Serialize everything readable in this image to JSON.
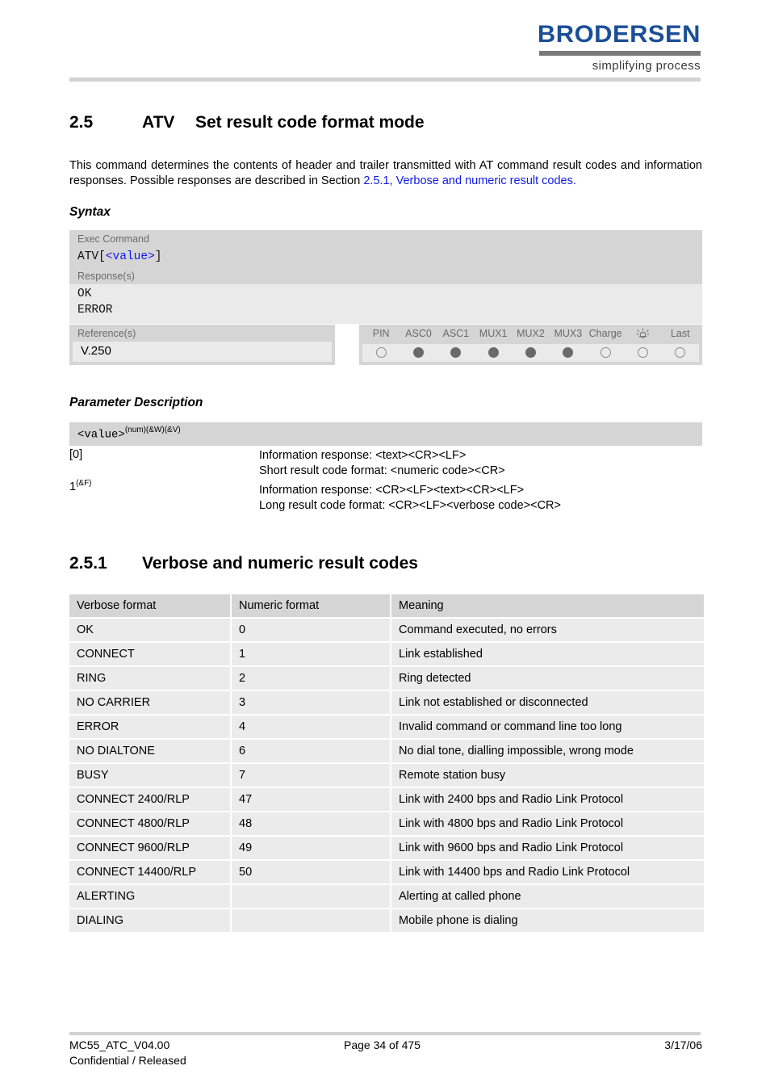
{
  "header": {
    "logo_word": "BRODERSEN",
    "logo_tagline": "simplifying process"
  },
  "section": {
    "number": "2.5",
    "command": "ATV",
    "title": "Set result code format mode"
  },
  "intro": {
    "text_before_link": "This command determines the contents of header and trailer transmitted with AT command result codes and information responses. Possible responses are described in Section ",
    "link_text": "2.5.1, Verbose and numeric result codes."
  },
  "syntax": {
    "heading": "Syntax",
    "exec_label": "Exec Command",
    "exec_prefix": "ATV[",
    "exec_value": "<value>",
    "exec_suffix": "]",
    "response_label": "Response(s)",
    "response_line1": "OK",
    "response_line2": "ERROR",
    "reference_label": "Reference(s)",
    "reference_value": "V.250",
    "indicators": [
      {
        "label": "PIN",
        "state": "empty"
      },
      {
        "label": "ASC0",
        "state": "filled"
      },
      {
        "label": "ASC1",
        "state": "filled"
      },
      {
        "label": "MUX1",
        "state": "filled"
      },
      {
        "label": "MUX2",
        "state": "filled"
      },
      {
        "label": "MUX3",
        "state": "filled"
      },
      {
        "label": "Charge",
        "state": "empty"
      },
      {
        "label": "alarm-bell-icon",
        "state": "empty"
      },
      {
        "label": "Last",
        "state": "empty"
      }
    ]
  },
  "parameter": {
    "heading": "Parameter Description",
    "name": "<value>",
    "name_sup": "(num)(&W)(&V)",
    "rows": [
      {
        "key": "[0]",
        "key_sup": "",
        "line1": "Information response: <text><CR><LF>",
        "line2": "Short result code format: <numeric code><CR>"
      },
      {
        "key": "1",
        "key_sup": "(&F)",
        "line1": "Information response: <CR><LF><text><CR><LF>",
        "line2": "Long result code format: <CR><LF><verbose code><CR>"
      }
    ]
  },
  "subsection": {
    "number": "2.5.1",
    "title": "Verbose and numeric result codes"
  },
  "codes_table": {
    "headers": [
      "Verbose format",
      "Numeric format",
      "Meaning"
    ],
    "rows": [
      [
        "OK",
        "0",
        "Command executed, no errors"
      ],
      [
        "CONNECT",
        "1",
        "Link established"
      ],
      [
        "RING",
        "2",
        "Ring detected"
      ],
      [
        "NO CARRIER",
        "3",
        "Link not established or disconnected"
      ],
      [
        "ERROR",
        "4",
        "Invalid command or command line too long"
      ],
      [
        "NO DIALTONE",
        "6",
        "No dial tone, dialling impossible, wrong mode"
      ],
      [
        "BUSY",
        "7",
        "Remote station busy"
      ],
      [
        "CONNECT 2400/RLP",
        "47",
        "Link with 2400 bps and Radio Link Protocol"
      ],
      [
        "CONNECT 4800/RLP",
        "48",
        "Link with 4800 bps and Radio Link Protocol"
      ],
      [
        "CONNECT 9600/RLP",
        "49",
        "Link with 9600 bps and Radio Link Protocol"
      ],
      [
        "CONNECT 14400/RLP",
        "50",
        "Link with 14400 bps and Radio Link Protocol"
      ],
      [
        "ALERTING",
        "",
        "Alerting at called phone"
      ],
      [
        "DIALING",
        "",
        "Mobile phone is dialing"
      ]
    ]
  },
  "footer": {
    "doc_id": "MC55_ATC_V04.00",
    "page": "Page 34 of 475",
    "date": "3/17/06",
    "classification": "Confidential / Released"
  },
  "colors": {
    "logo_blue": "#1b4f96",
    "link_blue": "#1119e8",
    "panel_dark": "#d5d5d5",
    "panel_light": "#eaeaea"
  }
}
